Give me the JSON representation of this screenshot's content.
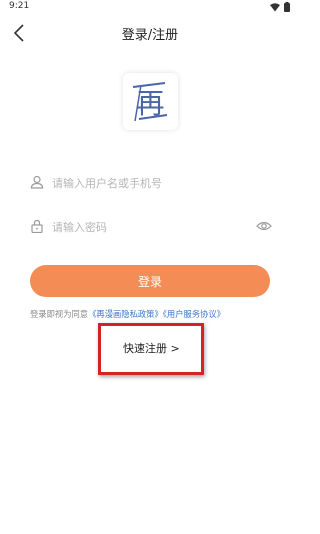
{
  "status": {
    "time": "9:21",
    "icons": [
      "wifi-icon",
      "battery-icon"
    ]
  },
  "nav": {
    "title": "登录/注册",
    "back_icon": "back-arrow-icon"
  },
  "logo": {
    "char": "再"
  },
  "form": {
    "user_placeholder": "请输入用户名或手机号",
    "password_placeholder": "请输入密码",
    "login_label": "登录"
  },
  "agreement": {
    "prefix": "登录即视为同意",
    "privacy": "《再漫画隐私政策》",
    "service": "《用户服务协议》"
  },
  "register": {
    "label": "快速注册 >"
  },
  "colors": {
    "accent": "#f48d55",
    "link": "#3a78c9",
    "highlight": "#d42323",
    "logo": "#4a66a8"
  }
}
